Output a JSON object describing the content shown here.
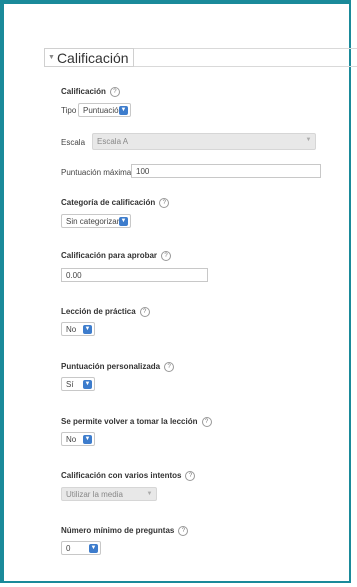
{
  "section": {
    "title": "Calificación"
  },
  "grade": {
    "label": "Calificación",
    "type_label": "Tipo",
    "type_value": "Puntuación",
    "scale_label": "Escala",
    "scale_value": "Escala A",
    "max_label": "Puntuación máxima",
    "max_value": "100"
  },
  "category": {
    "label": "Categoría de calificación",
    "value": "Sin categorizar"
  },
  "pass_grade": {
    "label": "Calificación para aprobar",
    "value": "0.00"
  },
  "practice": {
    "label": "Lección de práctica",
    "value": "No"
  },
  "custom_score": {
    "label": "Puntuación personalizada",
    "value": "Sí"
  },
  "retake": {
    "label": "Se permite volver a tomar la lección",
    "value": "No"
  },
  "multiple_attempts": {
    "label": "Calificación con varios intentos",
    "value": "Utilizar la media"
  },
  "min_questions": {
    "label": "Número mínimo de preguntas",
    "value": "0"
  },
  "icons": {
    "help": "help-icon",
    "dropdown": "chevron-down-icon",
    "collapse": "triangle-down-icon"
  },
  "colors": {
    "frame": "#1a8a9a",
    "select_arrow": "#3d7ccc"
  }
}
